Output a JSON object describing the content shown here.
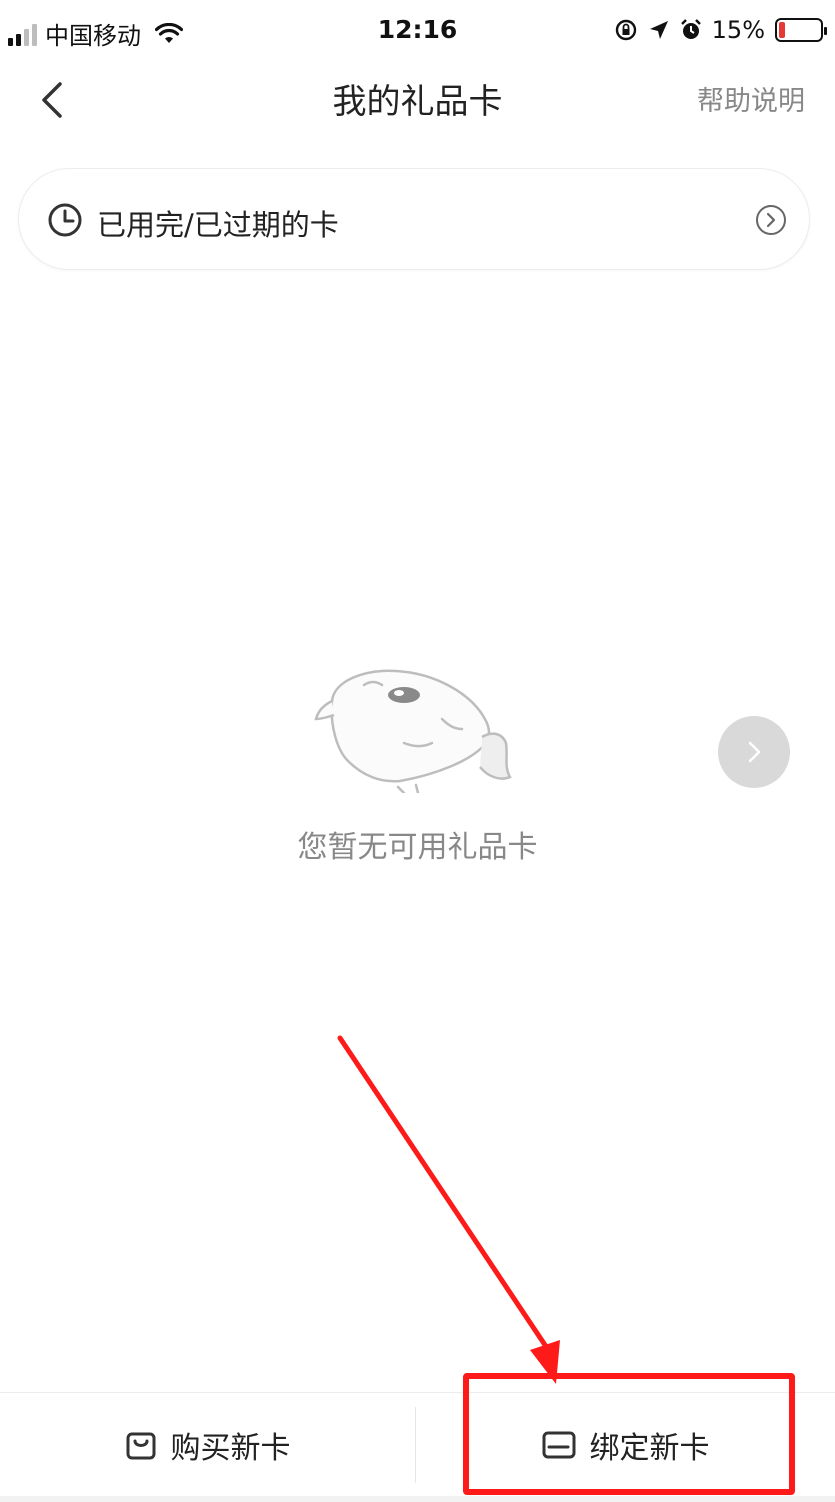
{
  "status_bar": {
    "carrier": "中国移动",
    "time": "12:16",
    "battery_percent": "15%",
    "battery_level": 0.15,
    "battery_color": "#e53935"
  },
  "nav": {
    "title": "我的礼品卡",
    "help_label": "帮助说明",
    "back_icon": "chevron-left-icon"
  },
  "expired_row": {
    "label": "已用完/已过期的卡",
    "icon": "clock-icon",
    "chevron_icon": "chevron-right-circle-icon"
  },
  "empty_state": {
    "message": "您暂无可用礼品卡",
    "illustration": "mascot-icon"
  },
  "bottom_bar": {
    "buy_label": "购买新卡",
    "buy_icon": "shopping-bag-icon",
    "bind_label": "绑定新卡",
    "bind_icon": "card-icon"
  },
  "annotation": {
    "color": "#ff1a1a"
  }
}
